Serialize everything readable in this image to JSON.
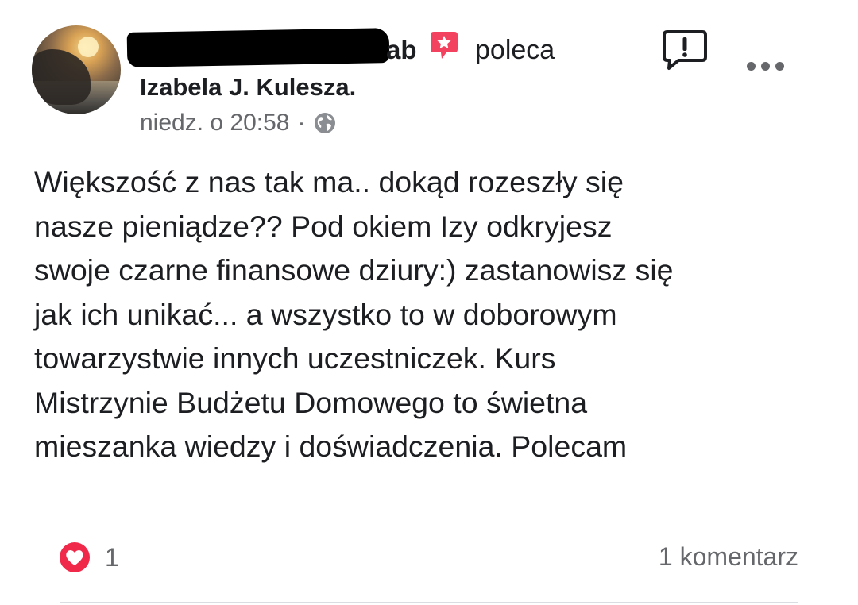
{
  "post": {
    "author_suffix": "ab",
    "action": "poleca",
    "page_name": "Izabela J. Kulesza.",
    "timestamp": "niedz. o 20:58",
    "separator": "·",
    "body": "Większość z nas tak ma.. dokąd rozeszły się\nnasze pieniądze?? Pod okiem Izy odkryjesz\nswoje czarne finansowe dziury:) zastanowisz się\njak ich unikać... a wszystko to w doborowym\ntowarzystwie innych uczestniczek. Kurs\nMistrzynie Budżetu Domowego to świetna\nmieszanka wiedzy i doświadczenia. Polecam",
    "reaction_count": "1",
    "comments_label": "1 komentarz"
  },
  "icons": {
    "recommend": "recommend-star-icon",
    "report": "report-icon",
    "more": "more-options-icon",
    "audience": "globe-icon",
    "reaction": "love-reaction-icon"
  },
  "colors": {
    "text": "#1c1e21",
    "secondary": "#65676b",
    "recommend": "#f3425f",
    "love": "#f02849"
  }
}
